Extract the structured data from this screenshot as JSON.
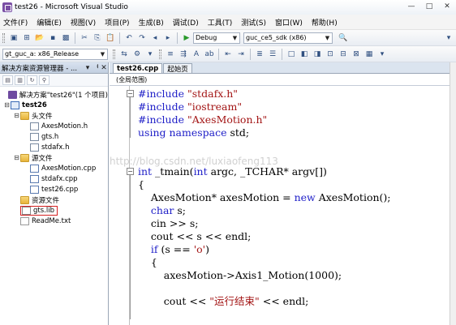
{
  "window": {
    "title": "test26 - Microsoft Visual Studio",
    "min": "—",
    "max": "□",
    "close": "✕"
  },
  "menu": [
    "文件(F)",
    "编辑(E)",
    "视图(V)",
    "项目(P)",
    "生成(B)",
    "调试(D)",
    "工具(T)",
    "测试(S)",
    "窗口(W)",
    "帮助(H)"
  ],
  "toolbar1": {
    "config": "Debug",
    "platform": "guc_ce5_sdk (x86)"
  },
  "toolbar2": {
    "target": "gt_guc_a: x86_Release"
  },
  "solution_explorer": {
    "title": "解决方案资源管理器 - ...",
    "pin": "▾",
    "autohide": "ᅧ",
    "close": "✕",
    "items": [
      {
        "label": "解决方案\"test26\"(1 个项目)",
        "type": "solution",
        "indent": 0,
        "expander": ""
      },
      {
        "label": "test26",
        "type": "project",
        "indent": 0,
        "expander": "⊟"
      },
      {
        "label": "头文件",
        "type": "folder",
        "indent": 1,
        "expander": "⊟"
      },
      {
        "label": "AxesMotion.h",
        "type": "hfile",
        "indent": 2,
        "expander": ""
      },
      {
        "label": "gts.h",
        "type": "hfile",
        "indent": 2,
        "expander": ""
      },
      {
        "label": "stdafx.h",
        "type": "hfile",
        "indent": 2,
        "expander": ""
      },
      {
        "label": "源文件",
        "type": "folder",
        "indent": 1,
        "expander": "⊟"
      },
      {
        "label": "AxesMotion.cpp",
        "type": "cppfile",
        "indent": 2,
        "expander": ""
      },
      {
        "label": "stdafx.cpp",
        "type": "cppfile",
        "indent": 2,
        "expander": ""
      },
      {
        "label": "test26.cpp",
        "type": "cppfile",
        "indent": 2,
        "expander": ""
      },
      {
        "label": "资源文件",
        "type": "folder",
        "indent": 1,
        "expander": ""
      },
      {
        "label": "gts.lib",
        "type": "libfile",
        "indent": 1,
        "expander": "",
        "highlight": true
      },
      {
        "label": "ReadMe.txt",
        "type": "txtfile",
        "indent": 1,
        "expander": ""
      }
    ]
  },
  "editor": {
    "tabs": [
      {
        "label": "test26.cpp",
        "active": true
      },
      {
        "label": "起始页",
        "active": false
      }
    ],
    "scope": "(全局范围)",
    "watermark": "http://blog.csdn.net/luxiaofeng113",
    "lines": [
      {
        "tokens": [
          {
            "t": "#include ",
            "c": "kw"
          },
          {
            "t": "\"stdafx.h\"",
            "c": "str"
          }
        ]
      },
      {
        "tokens": [
          {
            "t": "#include ",
            "c": "kw"
          },
          {
            "t": "\"iostream\"",
            "c": "str"
          }
        ]
      },
      {
        "tokens": [
          {
            "t": "#include ",
            "c": "kw"
          },
          {
            "t": "\"AxesMotion.h\"",
            "c": "str"
          }
        ]
      },
      {
        "tokens": [
          {
            "t": "using namespace",
            "c": "kw"
          },
          {
            "t": " std;",
            "c": ""
          }
        ]
      },
      {
        "tokens": []
      },
      {
        "tokens": []
      },
      {
        "tokens": [
          {
            "t": "int",
            "c": "kw"
          },
          {
            "t": " _tmain(",
            "c": ""
          },
          {
            "t": "int",
            "c": "kw"
          },
          {
            "t": " argc, _TCHAR* argv[])",
            "c": ""
          }
        ]
      },
      {
        "tokens": [
          {
            "t": "{",
            "c": ""
          }
        ]
      },
      {
        "tokens": [
          {
            "t": "    AxesMotion* axesMotion = ",
            "c": ""
          },
          {
            "t": "new",
            "c": "kw"
          },
          {
            "t": " AxesMotion();",
            "c": ""
          }
        ]
      },
      {
        "tokens": [
          {
            "t": "    ",
            "c": ""
          },
          {
            "t": "char",
            "c": "kw"
          },
          {
            "t": " s;",
            "c": ""
          }
        ]
      },
      {
        "tokens": [
          {
            "t": "    cin >> s;",
            "c": ""
          }
        ]
      },
      {
        "tokens": [
          {
            "t": "    cout << s << endl;",
            "c": ""
          }
        ]
      },
      {
        "tokens": [
          {
            "t": "    ",
            "c": ""
          },
          {
            "t": "if",
            "c": "kw"
          },
          {
            "t": " (s == ",
            "c": ""
          },
          {
            "t": "'o'",
            "c": "str"
          },
          {
            "t": ")",
            "c": ""
          }
        ]
      },
      {
        "tokens": [
          {
            "t": "    {",
            "c": ""
          }
        ]
      },
      {
        "tokens": [
          {
            "t": "        axesMotion->Axis1_Motion(1000);",
            "c": ""
          }
        ]
      },
      {
        "tokens": []
      },
      {
        "tokens": [
          {
            "t": "        cout << ",
            "c": ""
          },
          {
            "t": "\"运行结束\"",
            "c": "str"
          },
          {
            "t": " << endl;",
            "c": ""
          }
        ]
      }
    ]
  }
}
